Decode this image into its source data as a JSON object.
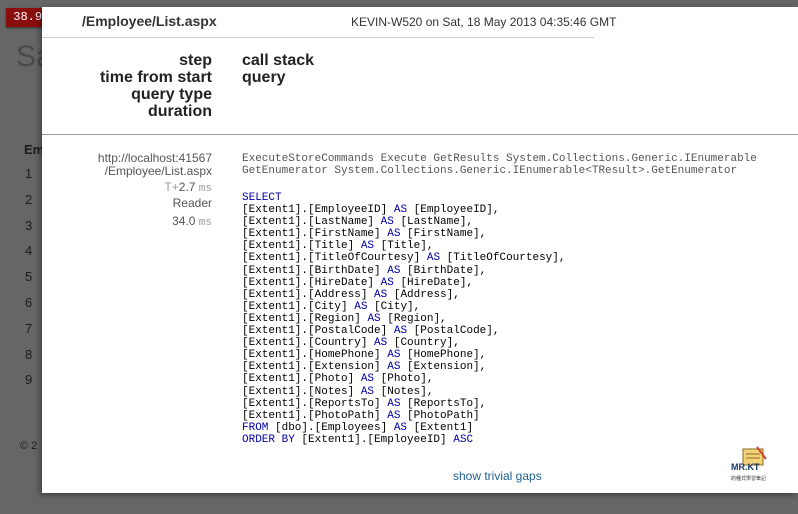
{
  "profiler_badge": "38.9 ms",
  "header": {
    "path": "/Employee/List.aspx",
    "meta": "KEVIN-W520 on Sat, 18 May 2013 04:35:46 GMT"
  },
  "columns": {
    "left": [
      "step",
      "time from start",
      "query type",
      "duration"
    ],
    "right": [
      "call stack",
      "query"
    ]
  },
  "entry": {
    "url": "http://localhost:41567\n/Employee/List.aspx",
    "time_prefix": "T+",
    "time_value": "2.7",
    "time_unit": "ms",
    "query_type": "Reader",
    "duration_value": "34.0",
    "duration_unit": "ms",
    "call_stack_line1": "ExecuteStoreCommands Execute GetResults System.Collections.Generic.IEnumerable",
    "call_stack_line2": "GetEnumerator System.Collections.Generic.IEnumerable<TResult>.GetEnumerator",
    "sql_select": "SELECT",
    "sql_columns": [
      [
        "[Extent1].[EmployeeID]",
        "[EmployeeID],"
      ],
      [
        "[Extent1].[LastName]",
        "[LastName],"
      ],
      [
        "[Extent1].[FirstName]",
        "[FirstName],"
      ],
      [
        "[Extent1].[Title]",
        "[Title],"
      ],
      [
        "[Extent1].[TitleOfCourtesy]",
        "[TitleOfCourtesy],"
      ],
      [
        "[Extent1].[BirthDate]",
        "[BirthDate],"
      ],
      [
        "[Extent1].[HireDate]",
        "[HireDate],"
      ],
      [
        "[Extent1].[Address]",
        "[Address],"
      ],
      [
        "[Extent1].[City]",
        "[City],"
      ],
      [
        "[Extent1].[Region]",
        "[Region],"
      ],
      [
        "[Extent1].[PostalCode]",
        "[PostalCode],"
      ],
      [
        "[Extent1].[Country]",
        "[Country],"
      ],
      [
        "[Extent1].[HomePhone]",
        "[HomePhone],"
      ],
      [
        "[Extent1].[Extension]",
        "[Extension],"
      ],
      [
        "[Extent1].[Photo]",
        "[Photo],"
      ],
      [
        "[Extent1].[Notes]",
        "[Notes],"
      ],
      [
        "[Extent1].[ReportsTo]",
        "[ReportsTo],"
      ],
      [
        "[Extent1].[PhotoPath]",
        "[PhotoPath]"
      ]
    ],
    "sql_as": "AS",
    "sql_from_kw": "FROM",
    "sql_from_rest": " [dbo].[Employees] ",
    "sql_from_alias": " [Extent1]",
    "sql_order_kw": "ORDER BY",
    "sql_order_rest": " [Extent1].[EmployeeID] ",
    "sql_order_dir": "ASC"
  },
  "show_trivial_gaps": "show trivial gaps",
  "background": {
    "title": "Sa",
    "list_header": "Em",
    "row_numbers": [
      "1",
      "2",
      "3",
      "4",
      "5",
      "6",
      "7",
      "8",
      "9"
    ],
    "copyright": "© 2"
  },
  "watermark": {
    "brand": "MR.KT",
    "subtitle": "的種式學習筆記"
  },
  "colors": {
    "badge": "#8b0e0e",
    "keyword": "#0000aa",
    "link": "#1f5f8f"
  }
}
